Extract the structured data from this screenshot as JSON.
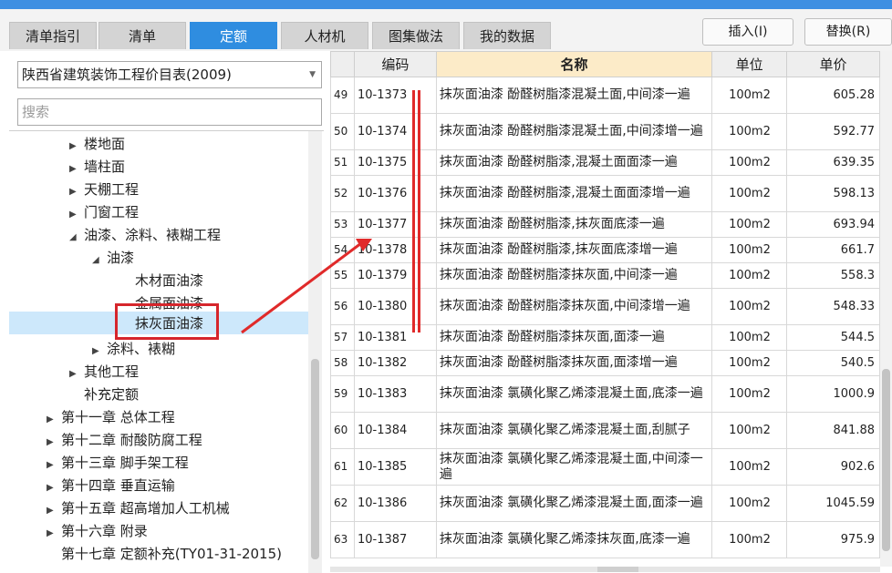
{
  "tabs": [
    {
      "label": "清单指引",
      "active": false
    },
    {
      "label": "清单",
      "active": false
    },
    {
      "label": "定额",
      "active": true
    },
    {
      "label": "人材机",
      "active": false
    },
    {
      "label": "图集做法",
      "active": false
    },
    {
      "label": "我的数据",
      "active": false
    }
  ],
  "toolbar": {
    "insert_label": "插入(I)",
    "replace_label": "替换(R)"
  },
  "library": {
    "selected": "陕西省建筑装饰工程价目表(2009)"
  },
  "search": {
    "placeholder": "搜索"
  },
  "tree": [
    {
      "label": "楼地面",
      "level": 2,
      "toggle": "collapsed"
    },
    {
      "label": "墙柱面",
      "level": 2,
      "toggle": "collapsed"
    },
    {
      "label": "天棚工程",
      "level": 2,
      "toggle": "collapsed"
    },
    {
      "label": "门窗工程",
      "level": 2,
      "toggle": "collapsed"
    },
    {
      "label": "油漆、涂料、裱糊工程",
      "level": 2,
      "toggle": "expanded"
    },
    {
      "label": "油漆",
      "level": 3,
      "toggle": "expanded"
    },
    {
      "label": "木材面油漆",
      "level": 4,
      "toggle": "none"
    },
    {
      "label": "金属面油漆",
      "level": 4,
      "toggle": "none"
    },
    {
      "label": "抹灰面油漆",
      "level": 4,
      "toggle": "none",
      "selected": true
    },
    {
      "label": "涂料、裱糊",
      "level": 3,
      "toggle": "collapsed"
    },
    {
      "label": "其他工程",
      "level": 2,
      "toggle": "collapsed"
    },
    {
      "label": "补充定额",
      "level": 2,
      "toggle": "none"
    },
    {
      "label": "第十一章 总体工程",
      "level": 1,
      "toggle": "collapsed"
    },
    {
      "label": "第十二章 耐酸防腐工程",
      "level": 1,
      "toggle": "collapsed"
    },
    {
      "label": "第十三章 脚手架工程",
      "level": 1,
      "toggle": "collapsed"
    },
    {
      "label": "第十四章 垂直运输",
      "level": 1,
      "toggle": "collapsed"
    },
    {
      "label": "第十五章 超高增加人工机械",
      "level": 1,
      "toggle": "collapsed"
    },
    {
      "label": "第十六章 附录",
      "level": 1,
      "toggle": "collapsed"
    },
    {
      "label": "第十七章 定额补充(TY01-31-2015)",
      "level": 1,
      "toggle": "none"
    }
  ],
  "grid": {
    "columns": [
      "编码",
      "名称",
      "单位",
      "单价"
    ],
    "rows": [
      {
        "idx": "49",
        "code": "10-1373",
        "name": "抹灰面油漆 酚醛树脂漆混凝土面,中间漆一遍",
        "unit": "100m2",
        "price": "605.28",
        "tall": true
      },
      {
        "idx": "50",
        "code": "10-1374",
        "name": "抹灰面油漆 酚醛树脂漆混凝土面,中间漆增一遍",
        "unit": "100m2",
        "price": "592.77",
        "tall": true
      },
      {
        "idx": "51",
        "code": "10-1375",
        "name": "抹灰面油漆 酚醛树脂漆,混凝土面面漆一遍",
        "unit": "100m2",
        "price": "639.35",
        "tall": false
      },
      {
        "idx": "52",
        "code": "10-1376",
        "name": "抹灰面油漆 酚醛树脂漆,混凝土面面漆增一遍",
        "unit": "100m2",
        "price": "598.13",
        "tall": true
      },
      {
        "idx": "53",
        "code": "10-1377",
        "name": "抹灰面油漆 酚醛树脂漆,抹灰面底漆一遍",
        "unit": "100m2",
        "price": "693.94",
        "tall": false
      },
      {
        "idx": "54",
        "code": "10-1378",
        "name": "抹灰面油漆 酚醛树脂漆,抹灰面底漆增一遍",
        "unit": "100m2",
        "price": "661.7",
        "tall": false
      },
      {
        "idx": "55",
        "code": "10-1379",
        "name": "抹灰面油漆 酚醛树脂漆抹灰面,中间漆一遍",
        "unit": "100m2",
        "price": "558.3",
        "tall": false
      },
      {
        "idx": "56",
        "code": "10-1380",
        "name": "抹灰面油漆 酚醛树脂漆抹灰面,中间漆增一遍",
        "unit": "100m2",
        "price": "548.33",
        "tall": true
      },
      {
        "idx": "57",
        "code": "10-1381",
        "name": "抹灰面油漆 酚醛树脂漆抹灰面,面漆一遍",
        "unit": "100m2",
        "price": "544.5",
        "tall": false
      },
      {
        "idx": "58",
        "code": "10-1382",
        "name": "抹灰面油漆 酚醛树脂漆抹灰面,面漆增一遍",
        "unit": "100m2",
        "price": "540.5",
        "tall": false
      },
      {
        "idx": "59",
        "code": "10-1383",
        "name": "抹灰面油漆 氯磺化聚乙烯漆混凝土面,底漆一遍",
        "unit": "100m2",
        "price": "1000.9",
        "tall": true
      },
      {
        "idx": "60",
        "code": "10-1384",
        "name": "抹灰面油漆 氯磺化聚乙烯漆混凝土面,刮腻子",
        "unit": "100m2",
        "price": "841.88",
        "tall": true
      },
      {
        "idx": "61",
        "code": "10-1385",
        "name": "抹灰面油漆 氯磺化聚乙烯漆混凝土面,中间漆一遍",
        "unit": "100m2",
        "price": "902.6",
        "tall": true
      },
      {
        "idx": "62",
        "code": "10-1386",
        "name": "抹灰面油漆 氯磺化聚乙烯漆混凝土面,面漆一遍",
        "unit": "100m2",
        "price": "1045.59",
        "tall": true
      },
      {
        "idx": "63",
        "code": "10-1387",
        "name": "抹灰面油漆 氯磺化聚乙烯漆抹灰面,底漆一遍",
        "unit": "100m2",
        "price": "975.9",
        "tall": true
      }
    ]
  },
  "colors": {
    "accent": "#2f8de0",
    "annotation": "#d6262c",
    "selected_row": "#cde8fb",
    "name_header": "#fcebc8"
  }
}
